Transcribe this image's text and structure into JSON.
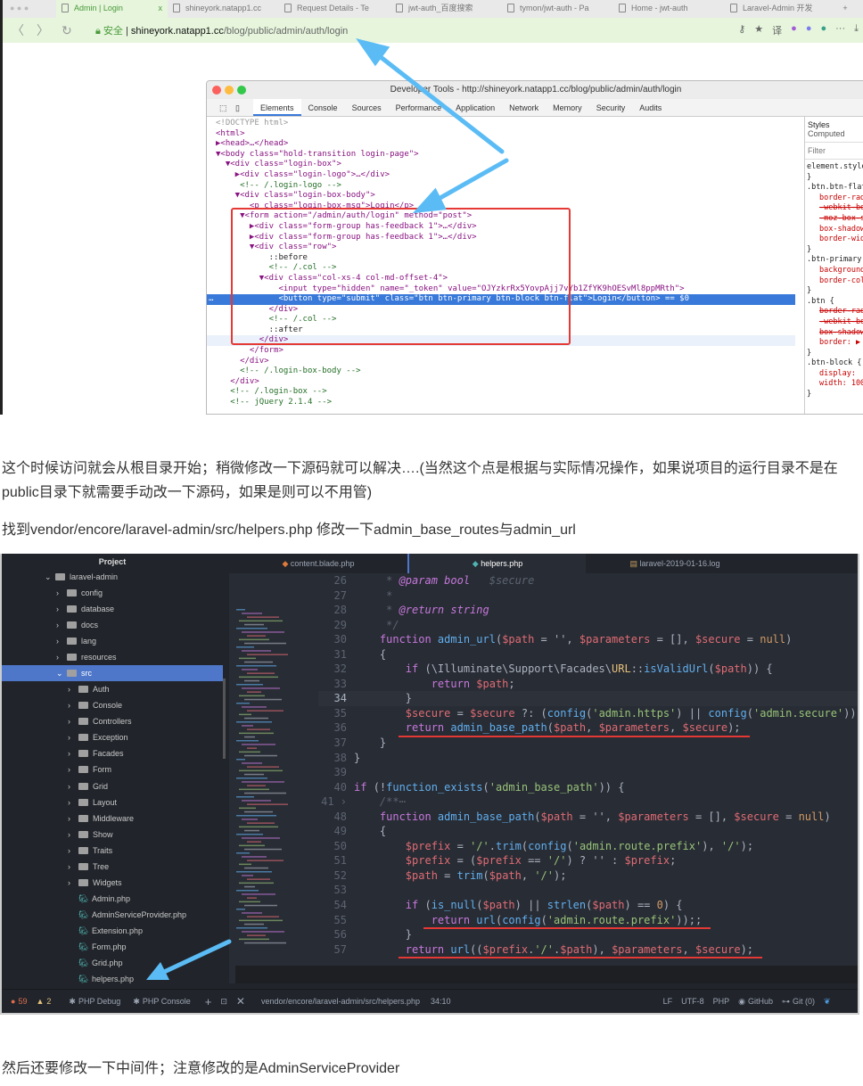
{
  "browser": {
    "tabs": [
      "Admin | Login",
      "shineyork.natapp1.cc",
      "Request Details - Te",
      "jwt-auth_百度搜索",
      "tymon/jwt-auth - Pa",
      "Home - jwt-auth",
      "Laravel-Admin 开发"
    ],
    "tab_close": "x",
    "new_tab": "+",
    "secure_label": "安全",
    "url_host": "shineyork.natapp1.cc",
    "url_path": "/blog/public/admin/auth/login",
    "toolbar_icons": [
      "key-icon",
      "star-icon",
      "translate-icon",
      "extension-icon",
      "extension-icon",
      "extension-icon",
      "more-icon",
      "download-icon"
    ],
    "translate": "译",
    "more": "···"
  },
  "devtools": {
    "title": "Developer Tools - http://shineyork.natapp1.cc/blog/public/admin/auth/login",
    "tabs": [
      "Elements",
      "Console",
      "Sources",
      "Performance",
      "Application",
      "Network",
      "Memory",
      "Security",
      "Audits"
    ],
    "active_tab": "Elements",
    "dom_lines": [
      "<!DOCTYPE html>",
      "<html>",
      "▶<head>…</head>",
      "▼<body class=\"hold-transition login-page\">",
      "  ▼<div class=\"login-box\">",
      "    ▶<div class=\"login-logo\">…</div>",
      "     <!-- /.login-logo -->",
      "    ▼<div class=\"login-box-body\">",
      "       <p class=\"login-box-msg\">Login</p>",
      "     ▼<form action=\"/admin/auth/login\" method=\"post\">",
      "       ▶<div class=\"form-group has-feedback 1\">…</div>",
      "       ▶<div class=\"form-group has-feedback 1\">…</div>",
      "       ▼<div class=\"row\">",
      "           ::before",
      "           <!-- /.col -->",
      "         ▼<div class=\"col-xs-4 col-md-offset-4\">",
      "             <input type=\"hidden\" name=\"_token\" value=\"OJYzkrRx5YovpAjj7vYb1ZfYK9hOESvMl8ppMRth\">",
      "             <button type=\"submit\" class=\"btn btn-primary btn-block btn-flat\">Login</button> == $0",
      "           </div>",
      "           <!-- /.col -->",
      "           ::after",
      "         </div>",
      "       </form>",
      "     </div>",
      "     <!-- /.login-box-body -->",
      "   </div>",
      "   <!-- /.login-box -->",
      "   <!-- jQuery 2.1.4 -->"
    ],
    "selected_line_marker": "…",
    "styles_tabs": [
      "Styles",
      "Computed"
    ],
    "filter_placeholder": "Filter",
    "styles_lines": [
      {
        "t": "element.style {",
        "c": ""
      },
      {
        "t": "}",
        "c": ""
      },
      {
        "t": ".btn.btn-flat {",
        "c": ""
      },
      {
        "t": "border-radius",
        "c": "p"
      },
      {
        "t": "-webkit-box-shadow",
        "c": "p s"
      },
      {
        "t": "-moz-box-shadow",
        "c": "p s"
      },
      {
        "t": "box-shadow",
        "c": "p"
      },
      {
        "t": "border-width",
        "c": "p"
      },
      {
        "t": "}",
        "c": ""
      },
      {
        "t": ".btn-primary {",
        "c": ""
      },
      {
        "t": "background-color",
        "c": "p"
      },
      {
        "t": "border-color",
        "c": "p"
      },
      {
        "t": "}",
        "c": ""
      },
      {
        "t": ".btn {",
        "c": ""
      },
      {
        "t": "border-radius",
        "c": "p s"
      },
      {
        "t": "-webkit-box-shadow",
        "c": "p s"
      },
      {
        "t": "box-shadow",
        "c": "p s"
      },
      {
        "t": "border: ▶",
        "c": "p"
      },
      {
        "t": "}",
        "c": ""
      },
      {
        "t": ".btn-block {",
        "c": ""
      },
      {
        "t": "display:",
        "c": "p"
      },
      {
        "t": "width: 100%",
        "c": "p"
      },
      {
        "t": "}",
        "c": ""
      }
    ]
  },
  "article": {
    "p1": "这个时候访问就会从根目录开始；稍微修改一下源码就可以解决….(当然这个点是根据与实际情况操作，如果说项目的运行目录不是在public目录下就需要手动改一下源码，如果是则可以不用管)",
    "p2": "找到vendor/encore/laravel-admin/src/helpers.php 修改一下admin_base_routes与admin_url",
    "p3": "然后还要修改一下中间件；注意修改的是AdminServiceProvider"
  },
  "editor": {
    "project_title": "Project",
    "tree": [
      {
        "label": "laravel-admin",
        "type": "folder",
        "depth": 0,
        "open": true
      },
      {
        "label": "config",
        "type": "folder",
        "depth": 1
      },
      {
        "label": "database",
        "type": "folder",
        "depth": 1
      },
      {
        "label": "docs",
        "type": "folder",
        "depth": 1
      },
      {
        "label": "lang",
        "type": "folder",
        "depth": 1
      },
      {
        "label": "resources",
        "type": "folder",
        "depth": 1
      },
      {
        "label": "src",
        "type": "folder",
        "depth": 1,
        "open": true,
        "selected": true
      },
      {
        "label": "Auth",
        "type": "folder",
        "depth": 2
      },
      {
        "label": "Console",
        "type": "folder",
        "depth": 2
      },
      {
        "label": "Controllers",
        "type": "folder",
        "depth": 2
      },
      {
        "label": "Exception",
        "type": "folder",
        "depth": 2
      },
      {
        "label": "Facades",
        "type": "folder",
        "depth": 2
      },
      {
        "label": "Form",
        "type": "folder",
        "depth": 2
      },
      {
        "label": "Grid",
        "type": "folder",
        "depth": 2
      },
      {
        "label": "Layout",
        "type": "folder",
        "depth": 2
      },
      {
        "label": "Middleware",
        "type": "folder",
        "depth": 2
      },
      {
        "label": "Show",
        "type": "folder",
        "depth": 2
      },
      {
        "label": "Traits",
        "type": "folder",
        "depth": 2
      },
      {
        "label": "Tree",
        "type": "folder",
        "depth": 2
      },
      {
        "label": "Widgets",
        "type": "folder",
        "depth": 2
      },
      {
        "label": "Admin.php",
        "type": "php",
        "depth": 2
      },
      {
        "label": "AdminServiceProvider.php",
        "type": "php",
        "depth": 2
      },
      {
        "label": "Extension.php",
        "type": "php",
        "depth": 2
      },
      {
        "label": "Form.php",
        "type": "php",
        "depth": 2
      },
      {
        "label": "Grid.php",
        "type": "php",
        "depth": 2
      },
      {
        "label": "helpers.php",
        "type": "php",
        "depth": 2
      }
    ],
    "tabs": [
      "content.blade.php",
      "helpers.php",
      "laravel-2019-01-16.log"
    ],
    "active_tab": "helpers.php",
    "code": [
      {
        "n": "26",
        "s": [
          [
            "c",
            "     * "
          ],
          [
            "d",
            "@param bool"
          ],
          [
            "c",
            "   $secure"
          ]
        ]
      },
      {
        "n": "27",
        "s": [
          [
            "c",
            "     *"
          ]
        ]
      },
      {
        "n": "28",
        "s": [
          [
            "c",
            "     * "
          ],
          [
            "d",
            "@return string"
          ]
        ]
      },
      {
        "n": "29",
        "s": [
          [
            "c",
            "     */"
          ]
        ]
      },
      {
        "n": "30",
        "s": [
          [
            "k",
            "    function "
          ],
          [
            "f",
            "admin_url"
          ],
          [
            "p",
            "("
          ],
          [
            "v",
            "$path"
          ],
          [
            "p",
            " = '', "
          ],
          [
            "v",
            "$parameters"
          ],
          [
            "p",
            " = [], "
          ],
          [
            "v",
            "$secure"
          ],
          [
            "p",
            " = "
          ],
          [
            "o",
            "null"
          ],
          [
            "p",
            ")"
          ]
        ]
      },
      {
        "n": "31",
        "s": [
          [
            "p",
            "    {"
          ]
        ]
      },
      {
        "n": "32",
        "s": [
          [
            "k",
            "        if "
          ],
          [
            "p",
            "(\\Illuminate\\Support\\Facades\\"
          ],
          [
            "y",
            "URL"
          ],
          [
            "p",
            "::"
          ],
          [
            "f",
            "isValidUrl"
          ],
          [
            "p",
            "("
          ],
          [
            "v",
            "$path"
          ],
          [
            "p",
            ")) {"
          ]
        ]
      },
      {
        "n": "33",
        "s": [
          [
            "k",
            "            return "
          ],
          [
            "v",
            "$path"
          ],
          [
            "p",
            ";"
          ]
        ]
      },
      {
        "n": "34",
        "s": [
          [
            "p",
            "        }"
          ]
        ],
        "cur": true
      },
      {
        "n": "35",
        "s": [
          [
            "v",
            "        $secure"
          ],
          [
            "p",
            " = "
          ],
          [
            "v",
            "$secure"
          ],
          [
            "p",
            " ?: ("
          ],
          [
            "f",
            "config"
          ],
          [
            "p",
            "("
          ],
          [
            "s",
            "'admin.https'"
          ],
          [
            "p",
            ") || "
          ],
          [
            "f",
            "config"
          ],
          [
            "p",
            "("
          ],
          [
            "s",
            "'admin.secure'"
          ],
          [
            "p",
            "));"
          ]
        ]
      },
      {
        "n": "36",
        "s": [
          [
            "k",
            "        return "
          ],
          [
            "f",
            "admin_base_path"
          ],
          [
            "p",
            "("
          ],
          [
            "v",
            "$path"
          ],
          [
            "p",
            ", "
          ],
          [
            "v",
            "$parameters"
          ],
          [
            "p",
            ", "
          ],
          [
            "v",
            "$secure"
          ],
          [
            "p",
            ");"
          ]
        ],
        "underline": true
      },
      {
        "n": "37",
        "s": [
          [
            "p",
            "    }"
          ]
        ]
      },
      {
        "n": "38",
        "s": [
          [
            "p",
            "}"
          ]
        ]
      },
      {
        "n": "39",
        "s": []
      },
      {
        "n": "40",
        "s": [
          [
            "k",
            "if "
          ],
          [
            "p",
            "(!"
          ],
          [
            "f",
            "function_exists"
          ],
          [
            "p",
            "("
          ],
          [
            "s",
            "'admin_base_path'"
          ],
          [
            "p",
            ")) {"
          ]
        ]
      },
      {
        "n": "41 ›",
        "s": [
          [
            "c",
            "    /**⋯"
          ]
        ]
      },
      {
        "n": "48",
        "s": [
          [
            "k",
            "    function "
          ],
          [
            "f",
            "admin_base_path"
          ],
          [
            "p",
            "("
          ],
          [
            "v",
            "$path"
          ],
          [
            "p",
            " = '', "
          ],
          [
            "v",
            "$parameters"
          ],
          [
            "p",
            " = [], "
          ],
          [
            "v",
            "$secure"
          ],
          [
            "p",
            " = "
          ],
          [
            "o",
            "null"
          ],
          [
            "p",
            ")"
          ]
        ]
      },
      {
        "n": "49",
        "s": [
          [
            "p",
            "    {"
          ]
        ]
      },
      {
        "n": "50",
        "s": [
          [
            "v",
            "        $prefix"
          ],
          [
            "p",
            " = "
          ],
          [
            "s",
            "'/'"
          ],
          [
            "p",
            "."
          ],
          [
            "f",
            "trim"
          ],
          [
            "p",
            "("
          ],
          [
            "f",
            "config"
          ],
          [
            "p",
            "("
          ],
          [
            "s",
            "'admin.route.prefix'"
          ],
          [
            "p",
            "), "
          ],
          [
            "s",
            "'/'"
          ],
          [
            "p",
            ");"
          ]
        ]
      },
      {
        "n": "51",
        "s": [
          [
            "v",
            "        $prefix"
          ],
          [
            "p",
            " = ("
          ],
          [
            "v",
            "$prefix"
          ],
          [
            "p",
            " == "
          ],
          [
            "s",
            "'/'"
          ],
          [
            "p",
            ") ? '' : "
          ],
          [
            "v",
            "$prefix"
          ],
          [
            "p",
            ";"
          ]
        ]
      },
      {
        "n": "52",
        "s": [
          [
            "v",
            "        $path"
          ],
          [
            "p",
            " = "
          ],
          [
            "f",
            "trim"
          ],
          [
            "p",
            "("
          ],
          [
            "v",
            "$path"
          ],
          [
            "p",
            ", "
          ],
          [
            "s",
            "'/'"
          ],
          [
            "p",
            ");"
          ]
        ]
      },
      {
        "n": "53",
        "s": []
      },
      {
        "n": "54",
        "s": [
          [
            "k",
            "        if "
          ],
          [
            "p",
            "("
          ],
          [
            "f",
            "is_null"
          ],
          [
            "p",
            "("
          ],
          [
            "v",
            "$path"
          ],
          [
            "p",
            ") || "
          ],
          [
            "f",
            "strlen"
          ],
          [
            "p",
            "("
          ],
          [
            "v",
            "$path"
          ],
          [
            "p",
            ") == "
          ],
          [
            "o",
            "0"
          ],
          [
            "p",
            ") {"
          ]
        ]
      },
      {
        "n": "55",
        "s": [
          [
            "k",
            "            return "
          ],
          [
            "f",
            "url"
          ],
          [
            "p",
            "("
          ],
          [
            "f",
            "config"
          ],
          [
            "p",
            "("
          ],
          [
            "s",
            "'admin.route.prefix'"
          ],
          [
            "p",
            "));;"
          ]
        ],
        "underline": true
      },
      {
        "n": "56",
        "s": [
          [
            "p",
            "        }"
          ]
        ]
      },
      {
        "n": "57",
        "s": [
          [
            "k",
            "        return "
          ],
          [
            "f",
            "url"
          ],
          [
            "p",
            "(("
          ],
          [
            "v",
            "$prefix"
          ],
          [
            "p",
            "."
          ],
          [
            "s",
            "'/'"
          ],
          [
            "p",
            "."
          ],
          [
            "v",
            "$path"
          ],
          [
            "p",
            "), "
          ],
          [
            "v",
            "$parameters"
          ],
          [
            "p",
            ", "
          ],
          [
            "v",
            "$secure"
          ],
          [
            "p",
            ");"
          ]
        ],
        "underline": true
      }
    ],
    "status": {
      "errors": "59",
      "warnings": "2",
      "php_debug": "PHP Debug",
      "php_console": "PHP Console",
      "path": "vendor/encore/laravel-admin/src/helpers.php",
      "cursor": "34:10",
      "line_ending": "LF",
      "encoding": "UTF-8",
      "grammar": "PHP",
      "github": "GitHub",
      "git": "Git (0)"
    }
  },
  "colors": {
    "annotation_red": "#e53935",
    "arrow_blue": "#5bbcf5",
    "selection_blue": "#4f77c9"
  }
}
